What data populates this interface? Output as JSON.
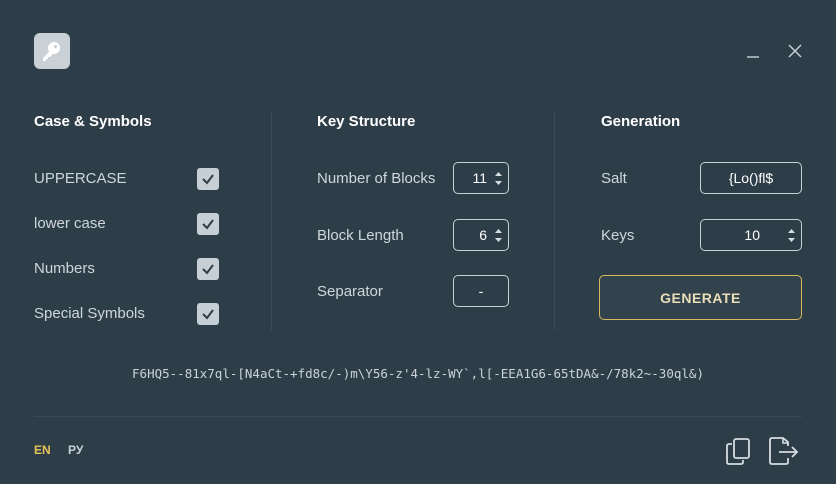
{
  "window": {
    "icons": {
      "app": "key-icon",
      "minimize": "minimize-icon",
      "close": "close-icon"
    }
  },
  "sections": {
    "case_symbols": {
      "title": "Case & Symbols",
      "options": [
        {
          "label": "UPPERCASE",
          "checked": true
        },
        {
          "label": "lower case",
          "checked": true
        },
        {
          "label": "Numbers",
          "checked": true
        },
        {
          "label": "Special Symbols",
          "checked": true
        }
      ]
    },
    "key_structure": {
      "title": "Key Structure",
      "number_of_blocks": {
        "label": "Number of Blocks",
        "value": "11"
      },
      "block_length": {
        "label": "Block Length",
        "value": "6"
      },
      "separator": {
        "label": "Separator",
        "value": "-"
      }
    },
    "generation": {
      "title": "Generation",
      "salt": {
        "label": "Salt",
        "value": "{Lo()fl$"
      },
      "keys": {
        "label": "Keys",
        "value": "10"
      },
      "generate_label": "GENERATE"
    }
  },
  "output": {
    "key": "F6HQ5--81x7ql-[N4aCt-+fd8c/-)m\\Y56-z'4-lz-WY`,l[-EEA1G6-65tDA&-/78k2~-30ql&)"
  },
  "footer": {
    "languages": [
      {
        "code": "EN",
        "active": true
      },
      {
        "code": "РУ",
        "active": false
      }
    ],
    "icons": {
      "copy": "copy-icon",
      "export": "export-icon"
    }
  },
  "colors": {
    "background": "#2e3e49",
    "accent": "#e8c35a",
    "generate_border": "#d8b85c"
  }
}
